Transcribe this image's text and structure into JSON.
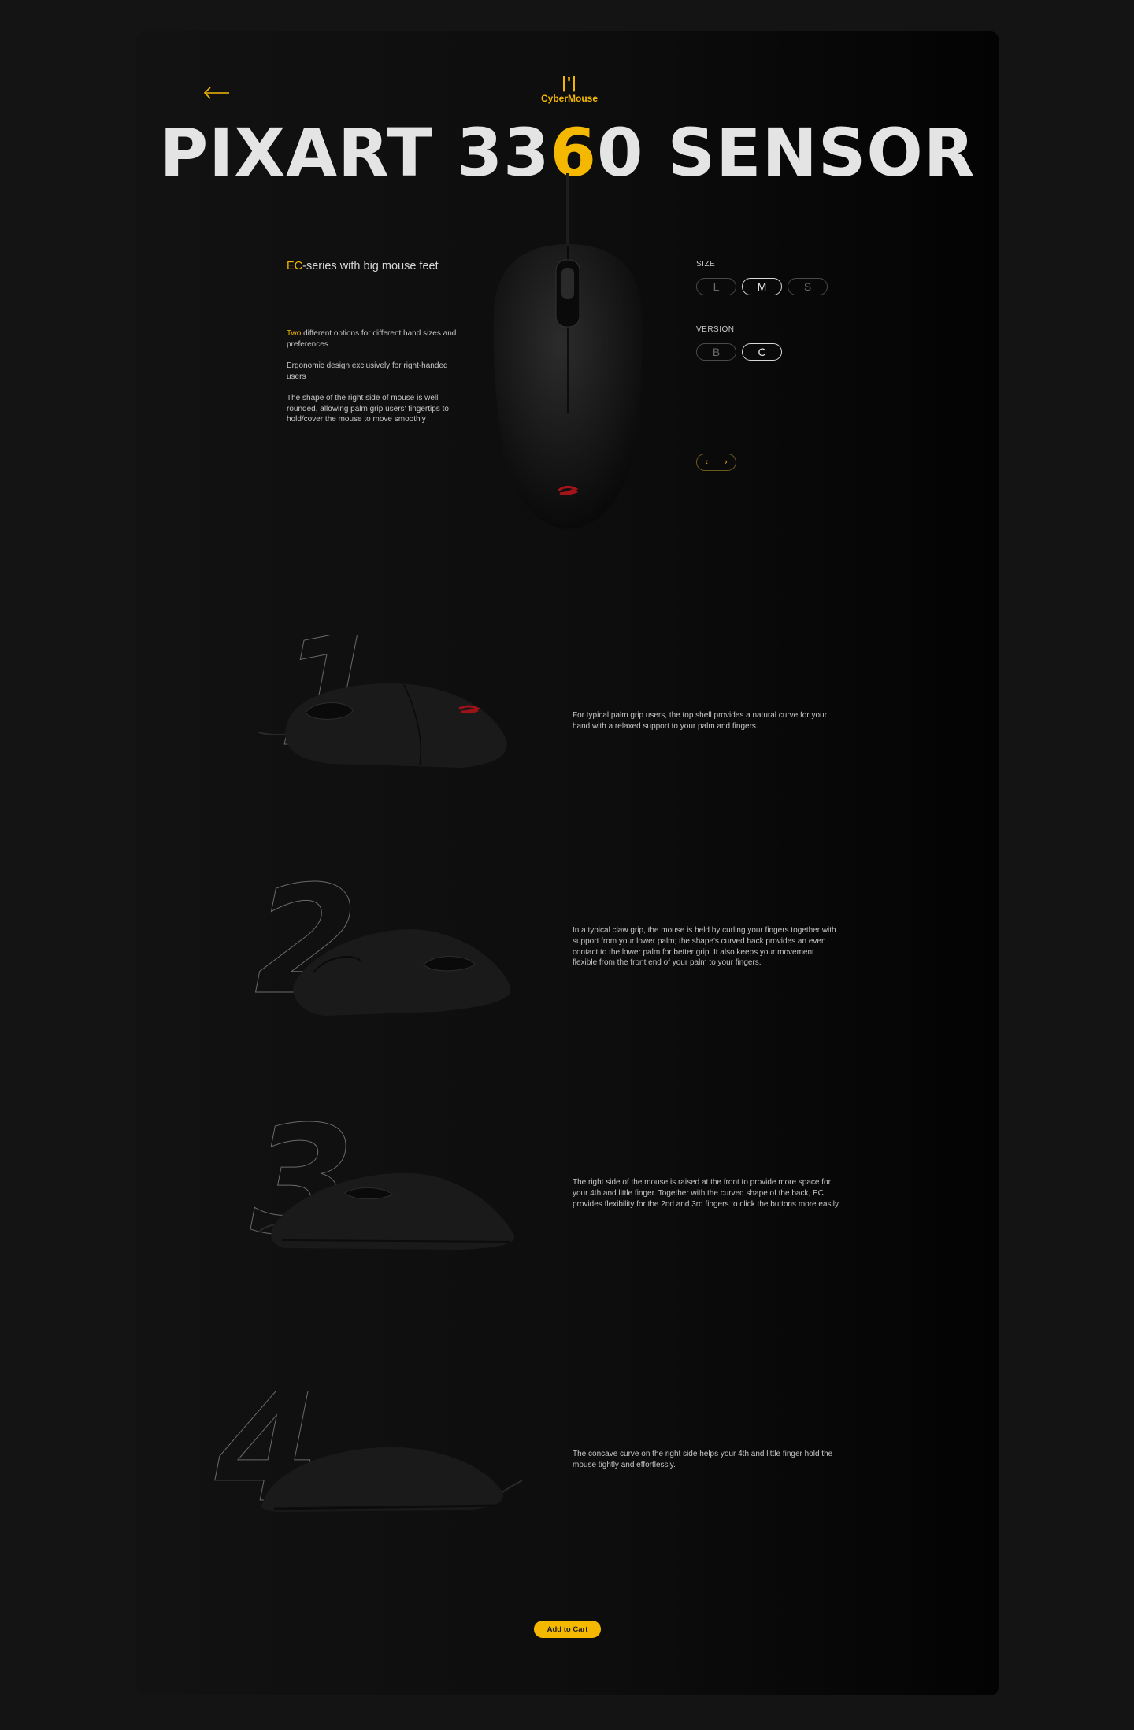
{
  "header": {
    "logo_mark": "|'|",
    "logo_text": "CyberMouse",
    "headline_start": "PIXART 33",
    "headline_accent": "6",
    "headline_end": "0 SENSOR"
  },
  "intro": {
    "tagline_accent": "EC",
    "tagline_rest": "-series with big mouse feet",
    "features": [
      {
        "accent": "Two",
        "text": " different options for different hand sizes and preferences"
      },
      {
        "accent": "",
        "text": "Ergonomic design exclusively for right-handed users"
      },
      {
        "accent": "",
        "text": "The shape of the right side of mouse is well rounded, allowing palm grip users' fingertips to hold/cover the mouse to move smoothly"
      }
    ]
  },
  "options": {
    "size_label": "SIZE",
    "sizes": [
      "L",
      "M",
      "S"
    ],
    "size_selected": "M",
    "version_label": "VERSION",
    "versions": [
      "B",
      "C"
    ],
    "version_selected": "C",
    "prev_icon": "chevron-left-icon",
    "next_icon": "chevron-right-icon",
    "prev_glyph": "‹",
    "next_glyph": "›"
  },
  "sections": [
    {
      "number": "1",
      "text": "For typical palm grip users, the top shell provides a natural curve for your hand with a relaxed support to your palm and fingers."
    },
    {
      "number": "2",
      "text": "In a typical claw grip, the mouse is held by curling your fingers together with support from your lower palm; the shape's curved back provides an even contact to the lower palm for better grip. It also keeps your movement flexible from the front end of your palm to your fingers."
    },
    {
      "number": "3",
      "text": "The right side of the mouse is raised at the front to provide more space for your 4th and little finger. Together with the curved shape of the back, EC provides flexibility for the 2nd and 3rd fingers to click the buttons more easily."
    },
    {
      "number": "4",
      "text": "The concave curve on the right side helps your 4th and little finger hold the mouse tightly and effortlessly."
    }
  ],
  "cta": {
    "label": "Add to Cart"
  },
  "colors": {
    "accent": "#f5b800",
    "background": "#141414",
    "card": "#0d0d0d",
    "text": "#d8d8d8"
  }
}
